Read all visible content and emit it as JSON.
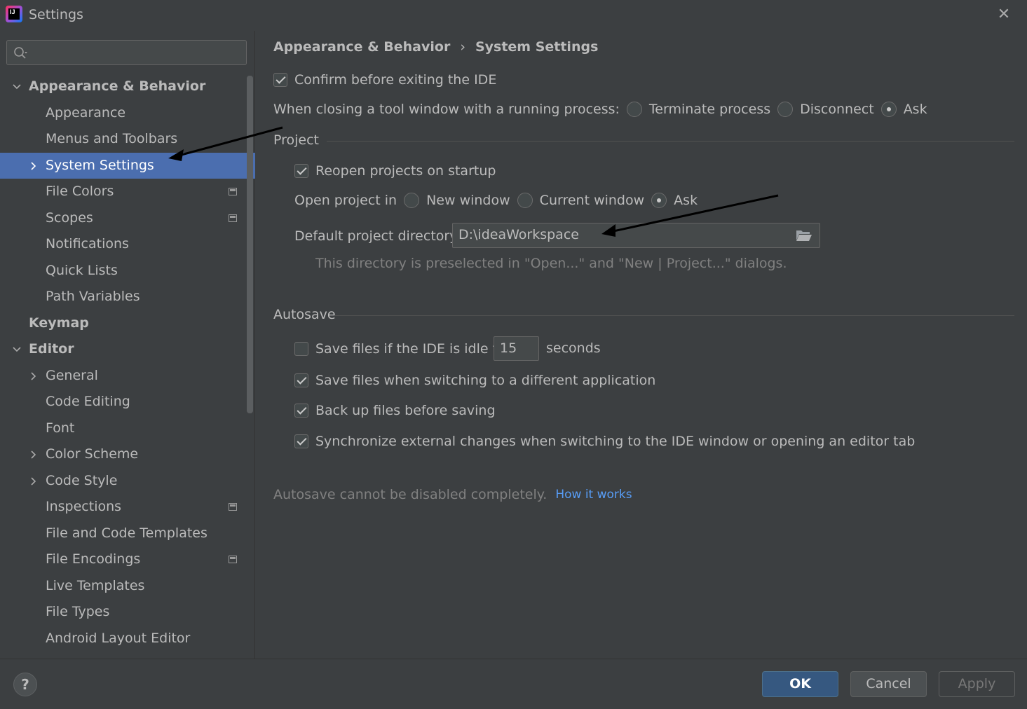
{
  "window": {
    "title": "Settings"
  },
  "search": {
    "placeholder": ""
  },
  "sidebar": {
    "items": [
      {
        "label": "Appearance & Behavior",
        "level": 0,
        "expanded": true,
        "chevron": "down",
        "icon": ""
      },
      {
        "label": "Appearance",
        "level": 1,
        "chevron": "",
        "icon": ""
      },
      {
        "label": "Menus and Toolbars",
        "level": 1,
        "chevron": "",
        "icon": ""
      },
      {
        "label": "System Settings",
        "level": 1,
        "chevron": "right",
        "selected": true,
        "icon": ""
      },
      {
        "label": "File Colors",
        "level": 1,
        "chevron": "",
        "icon": "project-icon"
      },
      {
        "label": "Scopes",
        "level": 1,
        "chevron": "",
        "icon": "project-icon"
      },
      {
        "label": "Notifications",
        "level": 1,
        "chevron": "",
        "icon": ""
      },
      {
        "label": "Quick Lists",
        "level": 1,
        "chevron": "",
        "icon": ""
      },
      {
        "label": "Path Variables",
        "level": 1,
        "chevron": "",
        "icon": ""
      },
      {
        "label": "Keymap",
        "level": 0,
        "chevron": "",
        "icon": ""
      },
      {
        "label": "Editor",
        "level": 0,
        "expanded": true,
        "chevron": "down",
        "icon": ""
      },
      {
        "label": "General",
        "level": 1,
        "chevron": "right",
        "icon": ""
      },
      {
        "label": "Code Editing",
        "level": 1,
        "chevron": "",
        "icon": ""
      },
      {
        "label": "Font",
        "level": 1,
        "chevron": "",
        "icon": ""
      },
      {
        "label": "Color Scheme",
        "level": 1,
        "chevron": "right",
        "icon": ""
      },
      {
        "label": "Code Style",
        "level": 1,
        "chevron": "right",
        "icon": ""
      },
      {
        "label": "Inspections",
        "level": 1,
        "chevron": "",
        "icon": "project-icon"
      },
      {
        "label": "File and Code Templates",
        "level": 1,
        "chevron": "",
        "icon": ""
      },
      {
        "label": "File Encodings",
        "level": 1,
        "chevron": "",
        "icon": "project-icon"
      },
      {
        "label": "Live Templates",
        "level": 1,
        "chevron": "",
        "icon": ""
      },
      {
        "label": "File Types",
        "level": 1,
        "chevron": "",
        "icon": ""
      },
      {
        "label": "Android Layout Editor",
        "level": 1,
        "chevron": "",
        "icon": ""
      }
    ]
  },
  "main": {
    "breadcrumb": {
      "parent": "Appearance & Behavior",
      "separator": "›",
      "current": "System Settings"
    },
    "confirm_exit": {
      "label": "Confirm before exiting the IDE",
      "checked": true
    },
    "tool_window": {
      "label": "When closing a tool window with a running process:",
      "options": [
        {
          "label": "Terminate process",
          "selected": false
        },
        {
          "label": "Disconnect",
          "selected": false
        },
        {
          "label": "Ask",
          "selected": true
        }
      ]
    },
    "project": {
      "title": "Project",
      "reopen": {
        "label": "Reopen projects on startup",
        "checked": true
      },
      "open_in": {
        "label": "Open project in",
        "options": [
          {
            "label": "New window",
            "selected": false
          },
          {
            "label": "Current window",
            "selected": false
          },
          {
            "label": "Ask",
            "selected": true
          }
        ]
      },
      "default_dir": {
        "label": "Default project directory:",
        "value": "D:\\ideaWorkspace",
        "icon": "folder-icon"
      },
      "hint": "This directory is preselected in \"Open...\" and \"New | Project...\" dialogs."
    },
    "autosave": {
      "title": "Autosave",
      "idle": {
        "label": "Save files if the IDE is idle for",
        "checked": false,
        "value": "15",
        "unit": "seconds"
      },
      "switching": {
        "label": "Save files when switching to a different application",
        "checked": true
      },
      "backup": {
        "label": "Back up files before saving",
        "checked": true
      },
      "sync": {
        "label": "Synchronize external changes when switching to the IDE window or opening an editor tab",
        "checked": true
      },
      "note": "Autosave cannot be disabled completely.",
      "link": "How it works"
    }
  },
  "footer": {
    "help": "?",
    "ok": "OK",
    "cancel": "Cancel",
    "apply": "Apply"
  },
  "colors": {
    "background": "#3c3f41",
    "selection": "#4b6eaf",
    "ok_button": "#365880",
    "link": "#589df6",
    "annotation_arrow": "#000000"
  }
}
